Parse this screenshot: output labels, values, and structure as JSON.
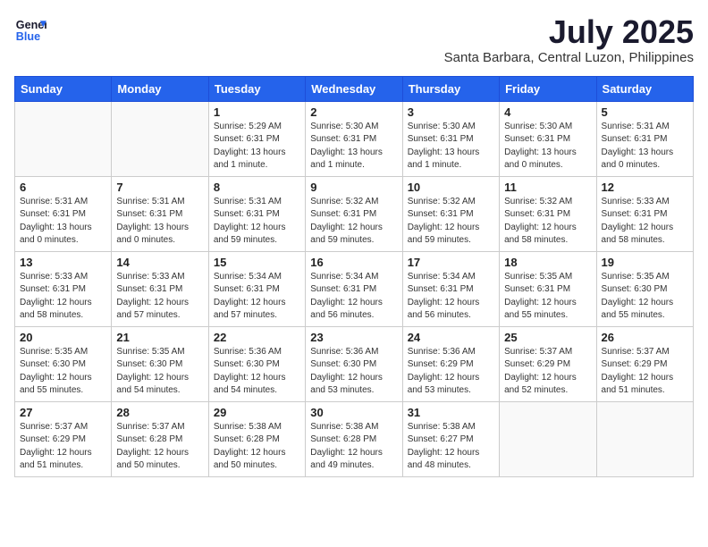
{
  "logo": {
    "line1": "General",
    "line2": "Blue"
  },
  "title": "July 2025",
  "location": "Santa Barbara, Central Luzon, Philippines",
  "days_header": [
    "Sunday",
    "Monday",
    "Tuesday",
    "Wednesday",
    "Thursday",
    "Friday",
    "Saturday"
  ],
  "weeks": [
    [
      {
        "day": "",
        "info": ""
      },
      {
        "day": "",
        "info": ""
      },
      {
        "day": "1",
        "info": "Sunrise: 5:29 AM\nSunset: 6:31 PM\nDaylight: 13 hours and 1 minute."
      },
      {
        "day": "2",
        "info": "Sunrise: 5:30 AM\nSunset: 6:31 PM\nDaylight: 13 hours and 1 minute."
      },
      {
        "day": "3",
        "info": "Sunrise: 5:30 AM\nSunset: 6:31 PM\nDaylight: 13 hours and 1 minute."
      },
      {
        "day": "4",
        "info": "Sunrise: 5:30 AM\nSunset: 6:31 PM\nDaylight: 13 hours and 0 minutes."
      },
      {
        "day": "5",
        "info": "Sunrise: 5:31 AM\nSunset: 6:31 PM\nDaylight: 13 hours and 0 minutes."
      }
    ],
    [
      {
        "day": "6",
        "info": "Sunrise: 5:31 AM\nSunset: 6:31 PM\nDaylight: 13 hours and 0 minutes."
      },
      {
        "day": "7",
        "info": "Sunrise: 5:31 AM\nSunset: 6:31 PM\nDaylight: 13 hours and 0 minutes."
      },
      {
        "day": "8",
        "info": "Sunrise: 5:31 AM\nSunset: 6:31 PM\nDaylight: 12 hours and 59 minutes."
      },
      {
        "day": "9",
        "info": "Sunrise: 5:32 AM\nSunset: 6:31 PM\nDaylight: 12 hours and 59 minutes."
      },
      {
        "day": "10",
        "info": "Sunrise: 5:32 AM\nSunset: 6:31 PM\nDaylight: 12 hours and 59 minutes."
      },
      {
        "day": "11",
        "info": "Sunrise: 5:32 AM\nSunset: 6:31 PM\nDaylight: 12 hours and 58 minutes."
      },
      {
        "day": "12",
        "info": "Sunrise: 5:33 AM\nSunset: 6:31 PM\nDaylight: 12 hours and 58 minutes."
      }
    ],
    [
      {
        "day": "13",
        "info": "Sunrise: 5:33 AM\nSunset: 6:31 PM\nDaylight: 12 hours and 58 minutes."
      },
      {
        "day": "14",
        "info": "Sunrise: 5:33 AM\nSunset: 6:31 PM\nDaylight: 12 hours and 57 minutes."
      },
      {
        "day": "15",
        "info": "Sunrise: 5:34 AM\nSunset: 6:31 PM\nDaylight: 12 hours and 57 minutes."
      },
      {
        "day": "16",
        "info": "Sunrise: 5:34 AM\nSunset: 6:31 PM\nDaylight: 12 hours and 56 minutes."
      },
      {
        "day": "17",
        "info": "Sunrise: 5:34 AM\nSunset: 6:31 PM\nDaylight: 12 hours and 56 minutes."
      },
      {
        "day": "18",
        "info": "Sunrise: 5:35 AM\nSunset: 6:31 PM\nDaylight: 12 hours and 55 minutes."
      },
      {
        "day": "19",
        "info": "Sunrise: 5:35 AM\nSunset: 6:30 PM\nDaylight: 12 hours and 55 minutes."
      }
    ],
    [
      {
        "day": "20",
        "info": "Sunrise: 5:35 AM\nSunset: 6:30 PM\nDaylight: 12 hours and 55 minutes."
      },
      {
        "day": "21",
        "info": "Sunrise: 5:35 AM\nSunset: 6:30 PM\nDaylight: 12 hours and 54 minutes."
      },
      {
        "day": "22",
        "info": "Sunrise: 5:36 AM\nSunset: 6:30 PM\nDaylight: 12 hours and 54 minutes."
      },
      {
        "day": "23",
        "info": "Sunrise: 5:36 AM\nSunset: 6:30 PM\nDaylight: 12 hours and 53 minutes."
      },
      {
        "day": "24",
        "info": "Sunrise: 5:36 AM\nSunset: 6:29 PM\nDaylight: 12 hours and 53 minutes."
      },
      {
        "day": "25",
        "info": "Sunrise: 5:37 AM\nSunset: 6:29 PM\nDaylight: 12 hours and 52 minutes."
      },
      {
        "day": "26",
        "info": "Sunrise: 5:37 AM\nSunset: 6:29 PM\nDaylight: 12 hours and 51 minutes."
      }
    ],
    [
      {
        "day": "27",
        "info": "Sunrise: 5:37 AM\nSunset: 6:29 PM\nDaylight: 12 hours and 51 minutes."
      },
      {
        "day": "28",
        "info": "Sunrise: 5:37 AM\nSunset: 6:28 PM\nDaylight: 12 hours and 50 minutes."
      },
      {
        "day": "29",
        "info": "Sunrise: 5:38 AM\nSunset: 6:28 PM\nDaylight: 12 hours and 50 minutes."
      },
      {
        "day": "30",
        "info": "Sunrise: 5:38 AM\nSunset: 6:28 PM\nDaylight: 12 hours and 49 minutes."
      },
      {
        "day": "31",
        "info": "Sunrise: 5:38 AM\nSunset: 6:27 PM\nDaylight: 12 hours and 48 minutes."
      },
      {
        "day": "",
        "info": ""
      },
      {
        "day": "",
        "info": ""
      }
    ]
  ]
}
